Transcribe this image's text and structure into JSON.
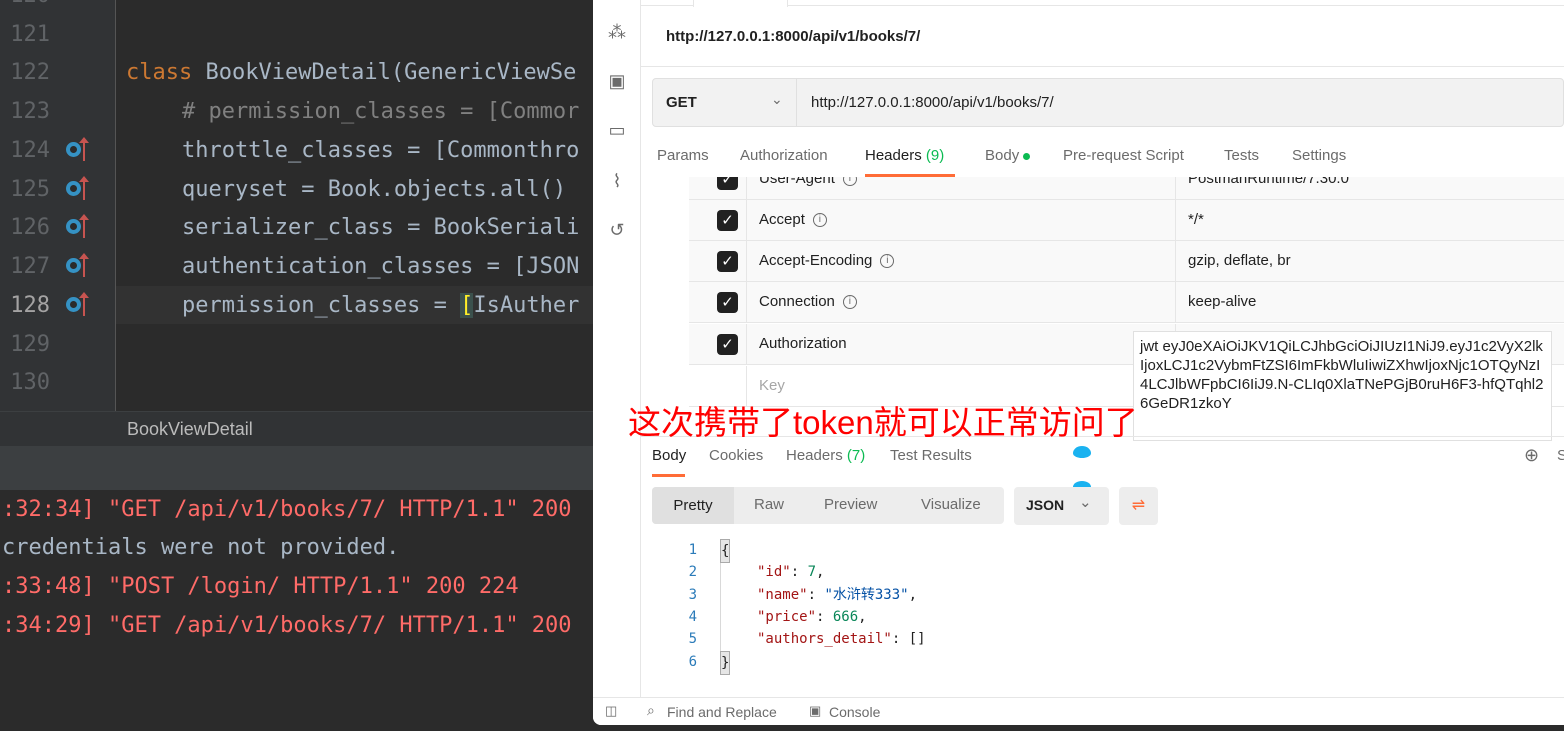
{
  "ide": {
    "line_numbers": [
      "120",
      "121",
      "122",
      "123",
      "124",
      "125",
      "126",
      "127",
      "128",
      "129",
      "130"
    ],
    "code": {
      "l122_kw": "class",
      "l122_rest": " BookViewDetail(GenericViewSe",
      "l123": "# permission_classes = [Commor",
      "l124": "throttle_classes = [Commonthro",
      "l125": "queryset = Book.objects.all()",
      "l126": "serializer_class = BookSeriali",
      "l127": "authentication_classes = [JSON",
      "l128_a": "permission_classes = ",
      "l128_b": "[",
      "l128_c": "IsAuther"
    },
    "breadcrumb": "BookViewDetail",
    "console": [
      ":32:34] \"GET /api/v1/books/7/ HTTP/1.1\" 200",
      "credentials were not provided.",
      ":33:48] \"POST /login/ HTTP/1.1\" 200 224",
      ":34:29] \"GET /api/v1/books/7/ HTTP/1.1\" 200"
    ]
  },
  "postman": {
    "title": "http://127.0.0.1:8000/api/v1/books/7/",
    "method": "GET",
    "url": "http://127.0.0.1:8000/api/v1/books/7/",
    "req_tabs": {
      "params": "Params",
      "authorization": "Authorization",
      "headers": "Headers",
      "headers_count": "(9)",
      "body": "Body",
      "prerequest": "Pre-request Script",
      "tests": "Tests",
      "settings": "Settings"
    },
    "headers": [
      {
        "key": "User-Agent",
        "value": "PostmanRuntime/7.30.0"
      },
      {
        "key": "Accept",
        "value": "*/*"
      },
      {
        "key": "Accept-Encoding",
        "value": "gzip, deflate, br"
      },
      {
        "key": "Connection",
        "value": "keep-alive"
      },
      {
        "key": "Authorization",
        "value": "jwt eyJ0eXAiOiJKV1QiLCJhbGciOiJIUzI1NiJ9.eyJ1c2VyX2lkIjoxLCJ1c2VybmFtZSI6ImFkbWluIiwiZXhwIjoxNjc1OTQyNzI4LCJlbWFpbCI6IiJ9.N-CLIq0XlaTNePGjB0ruH6F3-hfQTqhl26GeDR1zkoY"
      }
    ],
    "key_placeholder": "Key",
    "res_tabs": {
      "body": "Body",
      "cookies": "Cookies",
      "headers": "Headers",
      "headers_count": "(7)",
      "tests": "Test Results"
    },
    "view_modes": [
      "Pretty",
      "Raw",
      "Preview",
      "Visualize"
    ],
    "format": "JSON",
    "response_lines": [
      "1",
      "2",
      "3",
      "4",
      "5",
      "6"
    ],
    "json": {
      "id_key": "\"id\"",
      "id_val": "7",
      "name_key": "\"name\"",
      "name_val": "\"水浒转333\"",
      "price_key": "\"price\"",
      "price_val": "666",
      "authors_key": "\"authors_detail\"",
      "authors_val": "[]",
      "open": "{",
      "close": "}"
    },
    "footer": {
      "find": "Find and Replace",
      "console": "Console"
    },
    "cut_label": "S"
  },
  "annotation": "这次携带了token就可以正常访问了",
  "colors": {
    "accent": "#ff6c37",
    "annotation": "#ff0000",
    "log": "#ff6b68"
  }
}
